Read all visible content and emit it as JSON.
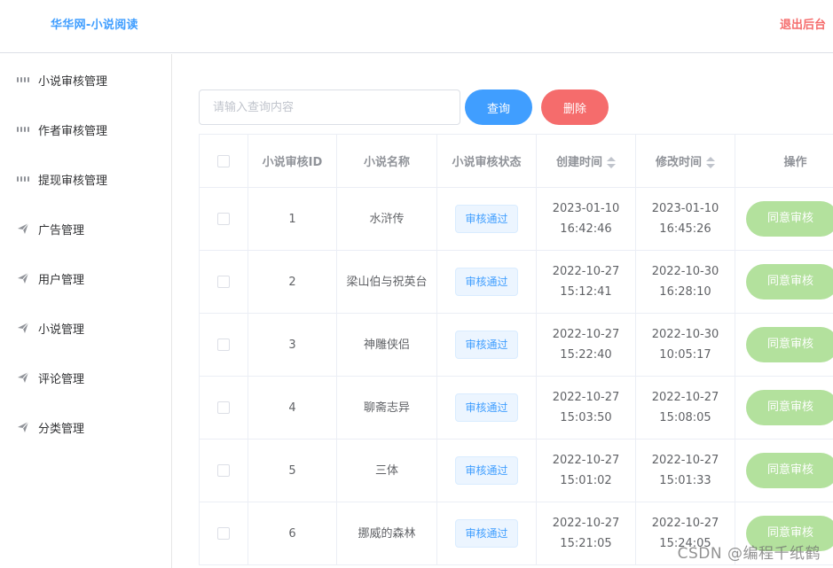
{
  "header": {
    "title": "华华网-小说阅读",
    "logout": "退出后台"
  },
  "sidebar": {
    "items": [
      {
        "label": "小说审核管理",
        "icon": "grid-icon"
      },
      {
        "label": "作者审核管理",
        "icon": "grid-icon"
      },
      {
        "label": "提现审核管理",
        "icon": "grid-icon"
      },
      {
        "label": "广告管理",
        "icon": "paper-plane-icon"
      },
      {
        "label": "用户管理",
        "icon": "paper-plane-icon"
      },
      {
        "label": "小说管理",
        "icon": "paper-plane-icon"
      },
      {
        "label": "评论管理",
        "icon": "paper-plane-icon"
      },
      {
        "label": "分类管理",
        "icon": "paper-plane-icon"
      }
    ]
  },
  "toolbar": {
    "search_placeholder": "请输入查询内容",
    "query_label": "查询",
    "delete_label": "删除"
  },
  "table": {
    "columns": [
      "小说审核ID",
      "小说名称",
      "小说审核状态",
      "创建时间",
      "修改时间",
      "操作"
    ],
    "rows": [
      {
        "id": "1",
        "name": "水浒传",
        "status": "审核通过",
        "created": "2023-01-10 16:42:46",
        "modified": "2023-01-10 16:45:26",
        "action": "同意审核"
      },
      {
        "id": "2",
        "name": "梁山伯与祝英台",
        "status": "审核通过",
        "created": "2022-10-27 15:12:41",
        "modified": "2022-10-30 16:28:10",
        "action": "同意审核"
      },
      {
        "id": "3",
        "name": "神雕侠侣",
        "status": "审核通过",
        "created": "2022-10-27 15:22:40",
        "modified": "2022-10-30 10:05:17",
        "action": "同意审核"
      },
      {
        "id": "4",
        "name": "聊斋志异",
        "status": "审核通过",
        "created": "2022-10-27 15:03:50",
        "modified": "2022-10-27 15:08:05",
        "action": "同意审核"
      },
      {
        "id": "5",
        "name": "三体",
        "status": "审核通过",
        "created": "2022-10-27 15:01:02",
        "modified": "2022-10-27 15:01:33",
        "action": "同意审核"
      },
      {
        "id": "6",
        "name": "挪威的森林",
        "status": "审核通过",
        "created": "2022-10-27 15:21:05",
        "modified": "2022-10-27 15:24:05",
        "action": "同意审核"
      }
    ]
  },
  "watermark": "CSDN @编程千纸鹤",
  "colors": {
    "primary": "#409eff",
    "danger": "#f56c6c",
    "success_light": "#b3e19d",
    "tag_bg": "#ecf5ff"
  }
}
